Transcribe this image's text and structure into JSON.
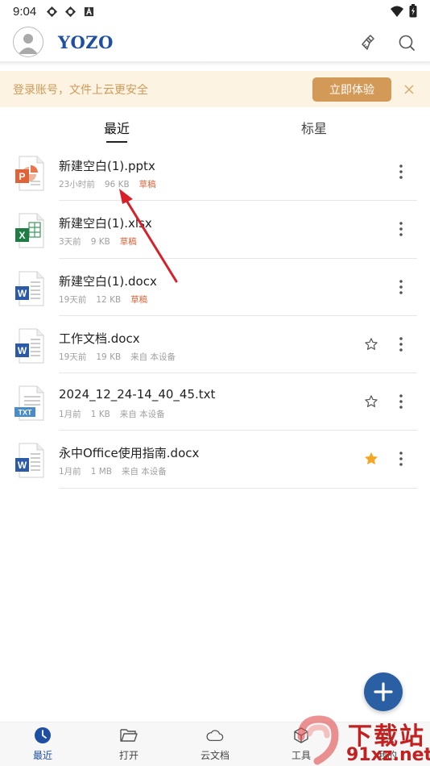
{
  "status_bar": {
    "time": "9:04"
  },
  "header": {
    "logo": "YOZO"
  },
  "banner": {
    "text": "登录账号，文件上云更安全",
    "button_label": "立即体验"
  },
  "tabs": [
    {
      "label": "最近",
      "active": true
    },
    {
      "label": "标星",
      "active": false
    }
  ],
  "files": [
    {
      "name": "新建空白(1).pptx",
      "time": "23小时前",
      "size": "96 KB",
      "tag": "草稿",
      "type": "pptx",
      "starrable": false,
      "starred": false
    },
    {
      "name": "新建空白(1).xlsx",
      "time": "3天前",
      "size": "9 KB",
      "tag": "草稿",
      "type": "xlsx",
      "starrable": false,
      "starred": false
    },
    {
      "name": "新建空白(1).docx",
      "time": "19天前",
      "size": "12 KB",
      "tag": "草稿",
      "type": "docx",
      "starrable": false,
      "starred": false
    },
    {
      "name": "工作文档.docx",
      "time": "19天前",
      "size": "19 KB",
      "source": "来自 本设备",
      "type": "docx",
      "starrable": true,
      "starred": false
    },
    {
      "name": "2024_12_24-14_40_45.txt",
      "time": "1月前",
      "size": "1 KB",
      "source": "来自 本设备",
      "type": "txt",
      "starrable": true,
      "starred": false
    },
    {
      "name": "永中Office使用指南.docx",
      "time": "1月前",
      "size": "1 MB",
      "source": "来自 本设备",
      "type": "docx",
      "starrable": true,
      "starred": true
    }
  ],
  "bottom_nav": [
    {
      "label": "最近",
      "icon": "clock-icon",
      "active": true
    },
    {
      "label": "打开",
      "icon": "folder-icon",
      "active": false
    },
    {
      "label": "云文档",
      "icon": "cloud-icon",
      "active": false
    },
    {
      "label": "工具",
      "icon": "toolbox-icon",
      "active": false
    },
    {
      "label": "我的",
      "icon": "user-icon",
      "active": false
    }
  ],
  "watermark": {
    "line1": "下载站",
    "line2": "91xz.net"
  },
  "colors": {
    "brand_blue": "#1f4fa3",
    "banner_bg": "#fdf3e2",
    "banner_button": "#d39a57",
    "draft_tag": "#e0643a",
    "star_active": "#f5a623",
    "fab": "#2b5fa3",
    "annotation_arrow": "#d8202a"
  }
}
